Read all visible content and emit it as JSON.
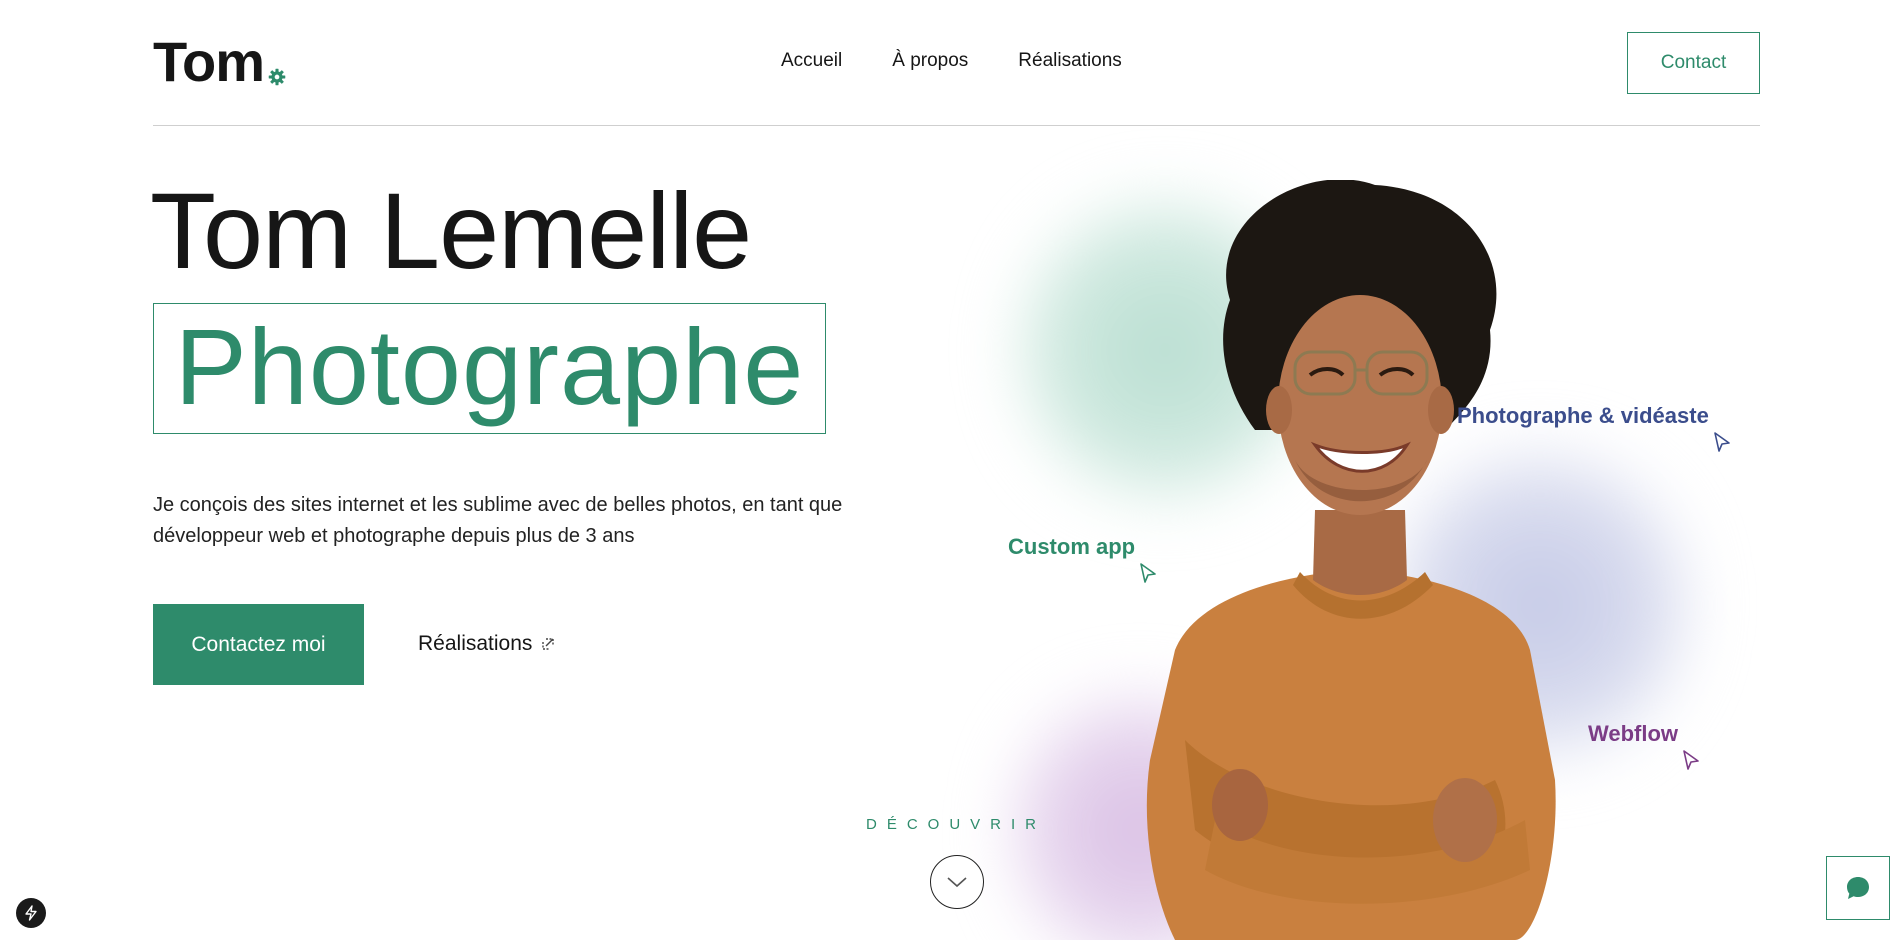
{
  "header": {
    "logo_text": "Tom",
    "nav": [
      {
        "label": "Accueil"
      },
      {
        "label": "À propos"
      },
      {
        "label": "Réalisations"
      }
    ],
    "contact_label": "Contact"
  },
  "hero": {
    "name": "Tom Lemelle",
    "role": "Photographe",
    "description": "Je conçois des sites internet et les sublime avec de belles photos, en tant que développeur web et photographe depuis plus de 3 ans",
    "cta_label": "Contactez moi",
    "secondary_label": "Réalisations",
    "discover_label": "DÉCOUVRIR"
  },
  "tags": {
    "photo": "Photographe & vidéaste",
    "custom": "Custom app",
    "webflow": "Webflow"
  },
  "colors": {
    "accent": "#2e8b6b",
    "tag_blue": "#3b4d8c",
    "tag_purple": "#7b3c86",
    "text": "#161616"
  },
  "icons": {
    "logo_mark": "gear-icon",
    "secondary_link": "external-link-icon",
    "scroll": "chevron-down-icon",
    "chat": "chat-icon",
    "badge": "lightning-icon",
    "tag_pointer": "cursor-pointer-icon"
  }
}
